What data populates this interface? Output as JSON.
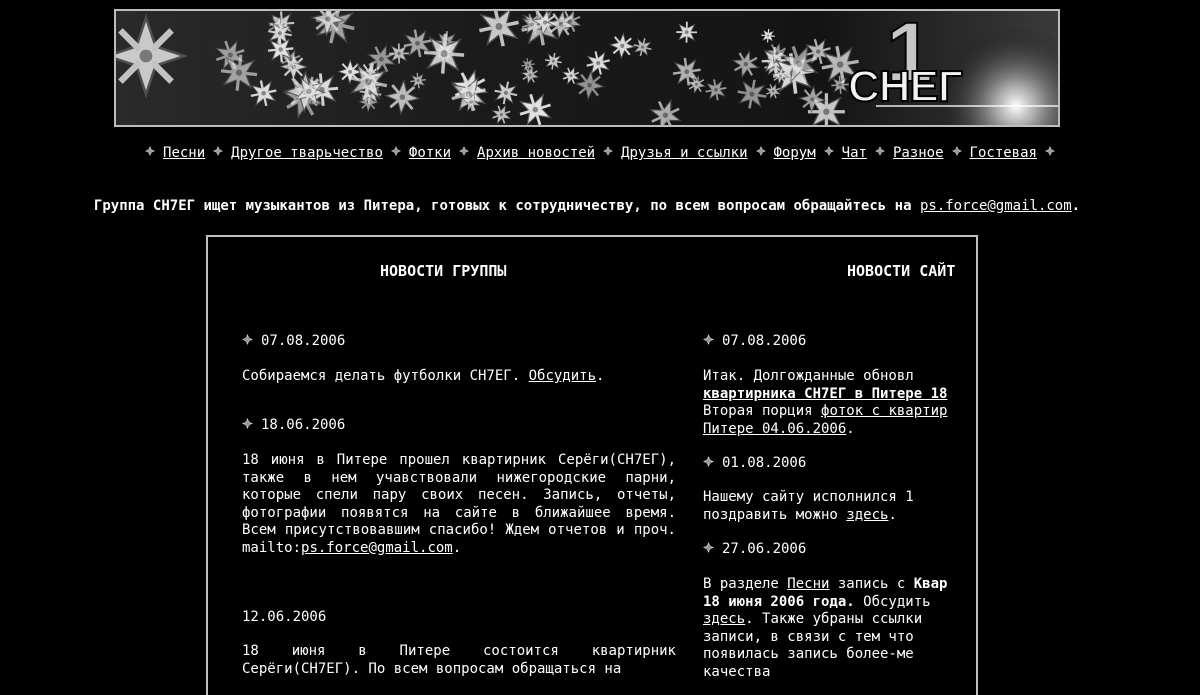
{
  "banner": {
    "logo_text": "СНЕГ",
    "logo_digit": "1"
  },
  "nav": {
    "items": [
      "Песни",
      "Другое тварьчество",
      "Фотки",
      "Архив новостей",
      "Друзья и ссылки",
      "Форум",
      "Чат",
      "Разное",
      "Гостевая"
    ]
  },
  "announcement": {
    "text": "Группа СН7ЕГ ищет музыкантов из Питера, готовых к сотрудничеству, по всем вопросам обращайтесь на",
    "email": "ps.force@gmail.com",
    "end": "."
  },
  "left": {
    "title": "НОВОСТИ ГРУППЫ",
    "news": [
      {
        "date": "07.08.2006",
        "text": "Собираемся делать футболки СН7ЕГ.",
        "link": "Обсудить",
        "end": "."
      },
      {
        "date": "18.06.2006",
        "text": "18 июня в Питере прошел квартирник Серёги(СН7ЕГ), также в нем учавствовали нижегородские парни, которые спели пару своих песен. Запись, отчеты, фотографии появятся на сайте в ближайшее время. Всем присутствовавшим спасибо! Ждем отчетов и проч. mailto:",
        "link": "ps.force@gmail.com",
        "end": "."
      },
      {
        "date": "12.06.2006",
        "text": "18 июня в Питере состоится квартирник Серёги(СН7ЕГ). По всем вопросам обращаться на"
      }
    ]
  },
  "right": {
    "title": "НОВОСТИ САЙТ",
    "news": [
      {
        "date": "07.08.2006",
        "l1": "Итак. Долгожданные обновл",
        "l2b": "квартирника СН7ЕГ в Питере 18",
        "l3": "Вторая порция ",
        "l3link": "фоток с квартир",
        "l4link": "Питере 04.06.2006",
        "l4end": "."
      },
      {
        "date": "01.08.2006",
        "l1": "Нашему сайту исполнился 1",
        "l2": "поздравить можно ",
        "l2link": "здесь",
        "l2end": "."
      },
      {
        "date": "27.06.2006",
        "l1a": "В разделе ",
        "l1link": "Песни",
        "l1b": " запись с ",
        "l1bold": "Квар",
        "l2bold": "18 июня 2006 года.",
        "l2": " Обсудить",
        "l3link": "здесь",
        "l3": ". Также убраны ссылки",
        "l4": "записи, в связи с тем что",
        "l5": "появилась запись более-ме",
        "l6": "качества"
      }
    ]
  }
}
